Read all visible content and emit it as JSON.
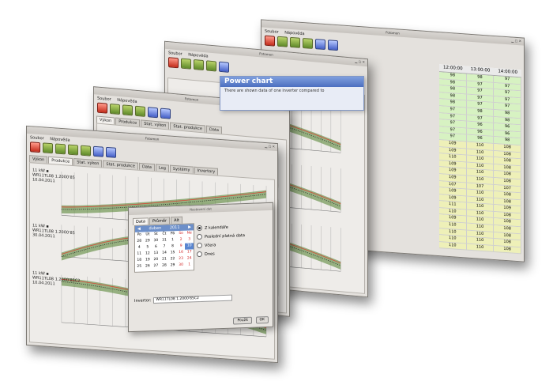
{
  "menu": {
    "file": "Soubor",
    "help": "Nápověda"
  },
  "windows": {
    "back": {
      "title": "Fotomon"
    },
    "third": {
      "title": "Fotomon"
    },
    "second": {
      "title": "Fotomon",
      "tabs": [
        "Výkon",
        "Produkce",
        "Stat. výkon",
        "Stat. produkce",
        "Data"
      ]
    },
    "front": {
      "title": "Fotomon",
      "tabs": [
        "Výkon",
        "Produkce",
        "Stat. výkon",
        "Stat. produkce",
        "Data",
        "Log",
        "Systémy",
        "Invertory"
      ],
      "active_tab": "Produkce",
      "series_labels": [
        "11 kW ▪\nWR11TL08 1.2000'85\n10.04.2011",
        "11 kW ▪\nWR11TL08 1.2000'85\n30.04.2011",
        "11 kW ▪\nWR11TL08 1.2000'85C2\n10.04.2011"
      ]
    }
  },
  "tooltip": {
    "title": "Power chart",
    "body": "There are shown data of one inverter compared to"
  },
  "dialog": {
    "title": "Nastavení dat",
    "tabs": [
      "Data",
      "Průměr",
      "Alt"
    ],
    "active_tab": "Data",
    "calendar": {
      "month": "duben",
      "year": "2011",
      "weekdays": [
        "Po",
        "Út",
        "St",
        "Čt",
        "Pá",
        "So",
        "Ne"
      ],
      "days": [
        "28",
        "29",
        "30",
        "31",
        "1",
        "2",
        "3",
        "4",
        "5",
        "6",
        "7",
        "8",
        "9",
        "10",
        "11",
        "12",
        "13",
        "14",
        "15",
        "16",
        "17",
        "18",
        "19",
        "20",
        "21",
        "22",
        "23",
        "24",
        "25",
        "26",
        "27",
        "28",
        "29",
        "30",
        "1"
      ],
      "selected": "10"
    },
    "radio_options": [
      "Z kalendáře",
      "Poslední platná data",
      "Včera",
      "Dnes"
    ],
    "selected_option": "Z kalendáře",
    "inverter_label": "Invertor:",
    "inverter_value": "WR11TL08 1.2000'85C2",
    "apply_label": "Použít",
    "ok_label": "OK"
  },
  "table": {
    "columns": [
      "12:00:00",
      "13:00:00",
      "14:00:00"
    ],
    "rows": [
      [
        "98",
        "98",
        "97"
      ],
      [
        "98",
        "97",
        "97"
      ],
      [
        "98",
        "97",
        "97"
      ],
      [
        "98",
        "97",
        "97"
      ],
      [
        "98",
        "97",
        "97"
      ],
      [
        "97",
        "98",
        "98"
      ],
      [
        "97",
        "97",
        "98"
      ],
      [
        "97",
        "96",
        "96"
      ],
      [
        "97",
        "96",
        "96"
      ],
      [
        "97",
        "96",
        "98"
      ],
      [
        "109",
        "110",
        "108"
      ],
      [
        "109",
        "110",
        "108"
      ],
      [
        "110",
        "110",
        "108"
      ],
      [
        "109",
        "110",
        "108"
      ],
      [
        "109",
        "110",
        "108"
      ],
      [
        "109",
        "110",
        "108"
      ],
      [
        "107",
        "107",
        "107"
      ],
      [
        "109",
        "110",
        "108"
      ],
      [
        "109",
        "110",
        "108"
      ],
      [
        "111",
        "110",
        "109"
      ],
      [
        "110",
        "110",
        "108"
      ],
      [
        "109",
        "110",
        "108"
      ],
      [
        "110",
        "110",
        "108"
      ],
      [
        "110",
        "110",
        "108"
      ],
      [
        "110",
        "110",
        "108"
      ],
      [
        "110",
        "110",
        "108"
      ]
    ]
  },
  "colors": {
    "green": "#4f7f2a",
    "red": "#d64a3a",
    "grid": "#a8a8a8",
    "row_green": "#d7f2c2",
    "row_yellow": "#eef0b8"
  }
}
